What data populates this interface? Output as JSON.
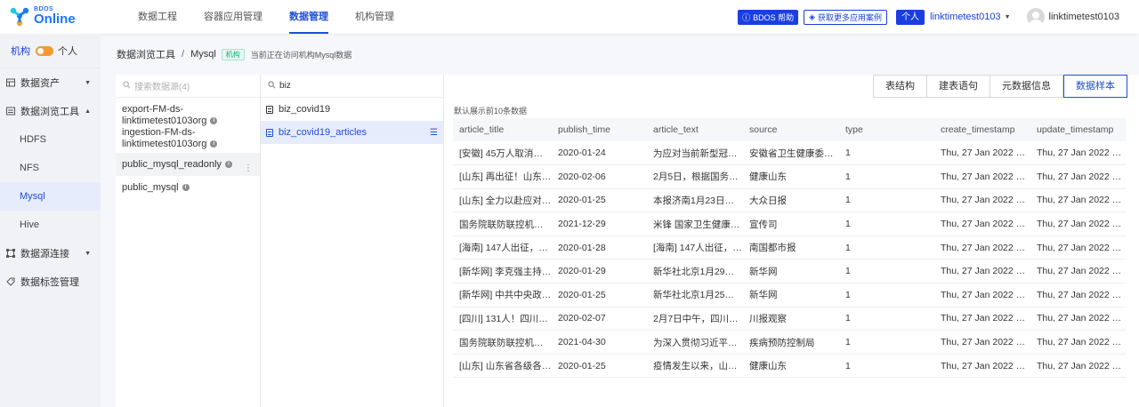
{
  "brand": {
    "small": "BDOS",
    "big": "Online"
  },
  "nav": [
    "数据工程",
    "容器应用管理",
    "数据管理",
    "机构管理"
  ],
  "top_right": {
    "help": "BDOS 帮助",
    "more_cases": "获取更多应用案例",
    "org_tag": "个人",
    "org_name": "linktimetest0103",
    "user_name": "linktimetest0103"
  },
  "sidebar": {
    "toggle_org": "机构",
    "toggle_personal": "个人",
    "items": [
      {
        "label": "数据资产",
        "icon": "table-icon"
      },
      {
        "label": "数据浏览工具",
        "icon": "browse-icon"
      },
      {
        "label": "数据源连接",
        "icon": "connection-icon"
      },
      {
        "label": "数据标签管理",
        "icon": "tag-icon"
      }
    ],
    "sub_items": [
      "HDFS",
      "NFS",
      "Mysql",
      "Hive"
    ]
  },
  "breadcrumb": {
    "root": "数据浏览工具",
    "current": "Mysql",
    "tag": "机构",
    "desc": "当前正在访问机构Mysql数据"
  },
  "datasources": {
    "placeholder": "搜索数据源(4)",
    "items": [
      {
        "line1": "export-FM-ds-",
        "line2": "linktimetest0103org"
      },
      {
        "line1": "ingestion-FM-ds-",
        "line2": "linktimetest0103org"
      },
      {
        "line1": "public_mysql_readonly"
      },
      {
        "line1": "public_mysql"
      }
    ]
  },
  "tables": {
    "search_value": "biz",
    "items": [
      "biz_covid19",
      "biz_covid19_articles"
    ]
  },
  "tabs": [
    "表结构",
    "建表语句",
    "元数据信息",
    "数据样本"
  ],
  "hint": "默认展示前10条数据",
  "grid": {
    "columns": [
      "article_title",
      "publish_time",
      "article_text",
      "source",
      "type",
      "create_timestamp",
      "update_timestamp"
    ],
    "rows": [
      [
        "[安徽] 45万人取消春…",
        "2020-01-24",
        "为应对当前新型冠…",
        "安徽省卫生健康委…",
        "1",
        "Thu, 27 Jan 2022 …",
        "Thu, 27 Jan 2022 …"
      ],
      [
        "[山东] 再出征！山东…",
        "2020-02-06",
        "2月5日，根据国务…",
        "健康山东",
        "1",
        "Thu, 27 Jan 2022 …",
        "Thu, 27 Jan 2022 …"
      ],
      [
        "[山东] 全力以赴应对…",
        "2020-01-25",
        "本报济南1月23日讯…",
        "大众日报",
        "1",
        "Thu, 27 Jan 2022 …",
        "Thu, 27 Jan 2022 …"
      ],
      [
        "国务院联防联控机制…",
        "2021-12-29",
        "米锋 国家卫生健康…",
        "宣传司",
        "1",
        "Thu, 27 Jan 2022 …",
        "Thu, 27 Jan 2022 …"
      ],
      [
        "[海南] 147人出征，…",
        "2020-01-28",
        "[海南] 147人出征，…",
        "南国都市报",
        "1",
        "Thu, 27 Jan 2022 …",
        "Thu, 27 Jan 2022 …"
      ],
      [
        "[新华网] 李克强主持…",
        "2020-01-29",
        "新华社北京1月29日…",
        "新华网",
        "1",
        "Thu, 27 Jan 2022 …",
        "Thu, 27 Jan 2022 …"
      ],
      [
        "[新华网] 中共中央政…",
        "2020-01-25",
        "新华社北京1月25日…",
        "新华网",
        "1",
        "Thu, 27 Jan 2022 …",
        "Thu, 27 Jan 2022 …"
      ],
      [
        "[四川] 131人！四川…",
        "2020-02-07",
        "2月7日中午，四川…",
        "川报观察",
        "1",
        "Thu, 27 Jan 2022 …",
        "Thu, 27 Jan 2022 …"
      ],
      [
        "国务院联防联控机制…",
        "2021-04-30",
        "为深入贯彻习近平…",
        "疾病预防控制局",
        "1",
        "Thu, 27 Jan 2022 …",
        "Thu, 27 Jan 2022 …"
      ],
      [
        "[山东] 山东省各级各…",
        "2020-01-25",
        "疫情发生以来，山…",
        "健康山东",
        "1",
        "Thu, 27 Jan 2022 …",
        "Thu, 27 Jan 2022 …"
      ]
    ]
  },
  "colors": {
    "accent": "#1f4fd6",
    "toggle": "#f29a2e",
    "tag_green": "#19a974"
  }
}
